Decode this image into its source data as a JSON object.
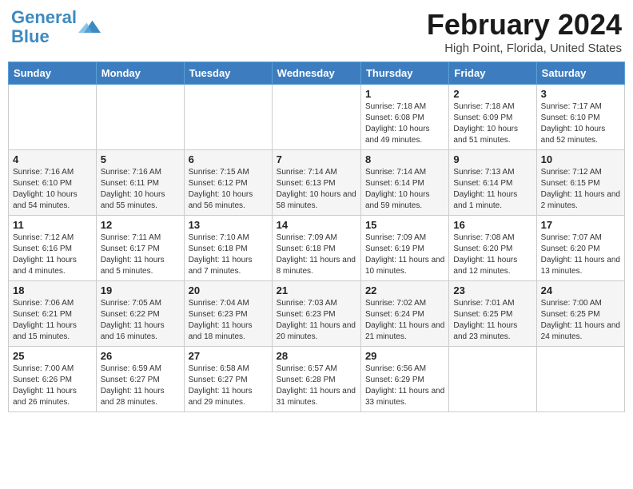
{
  "header": {
    "logo_line1": "General",
    "logo_line2": "Blue",
    "month_title": "February 2024",
    "location": "High Point, Florida, United States"
  },
  "days_of_week": [
    "Sunday",
    "Monday",
    "Tuesday",
    "Wednesday",
    "Thursday",
    "Friday",
    "Saturday"
  ],
  "weeks": [
    [
      {
        "day": "",
        "info": ""
      },
      {
        "day": "",
        "info": ""
      },
      {
        "day": "",
        "info": ""
      },
      {
        "day": "",
        "info": ""
      },
      {
        "day": "1",
        "info": "Sunrise: 7:18 AM\nSunset: 6:08 PM\nDaylight: 10 hours and 49 minutes."
      },
      {
        "day": "2",
        "info": "Sunrise: 7:18 AM\nSunset: 6:09 PM\nDaylight: 10 hours and 51 minutes."
      },
      {
        "day": "3",
        "info": "Sunrise: 7:17 AM\nSunset: 6:10 PM\nDaylight: 10 hours and 52 minutes."
      }
    ],
    [
      {
        "day": "4",
        "info": "Sunrise: 7:16 AM\nSunset: 6:10 PM\nDaylight: 10 hours and 54 minutes."
      },
      {
        "day": "5",
        "info": "Sunrise: 7:16 AM\nSunset: 6:11 PM\nDaylight: 10 hours and 55 minutes."
      },
      {
        "day": "6",
        "info": "Sunrise: 7:15 AM\nSunset: 6:12 PM\nDaylight: 10 hours and 56 minutes."
      },
      {
        "day": "7",
        "info": "Sunrise: 7:14 AM\nSunset: 6:13 PM\nDaylight: 10 hours and 58 minutes."
      },
      {
        "day": "8",
        "info": "Sunrise: 7:14 AM\nSunset: 6:14 PM\nDaylight: 10 hours and 59 minutes."
      },
      {
        "day": "9",
        "info": "Sunrise: 7:13 AM\nSunset: 6:14 PM\nDaylight: 11 hours and 1 minute."
      },
      {
        "day": "10",
        "info": "Sunrise: 7:12 AM\nSunset: 6:15 PM\nDaylight: 11 hours and 2 minutes."
      }
    ],
    [
      {
        "day": "11",
        "info": "Sunrise: 7:12 AM\nSunset: 6:16 PM\nDaylight: 11 hours and 4 minutes."
      },
      {
        "day": "12",
        "info": "Sunrise: 7:11 AM\nSunset: 6:17 PM\nDaylight: 11 hours and 5 minutes."
      },
      {
        "day": "13",
        "info": "Sunrise: 7:10 AM\nSunset: 6:18 PM\nDaylight: 11 hours and 7 minutes."
      },
      {
        "day": "14",
        "info": "Sunrise: 7:09 AM\nSunset: 6:18 PM\nDaylight: 11 hours and 8 minutes."
      },
      {
        "day": "15",
        "info": "Sunrise: 7:09 AM\nSunset: 6:19 PM\nDaylight: 11 hours and 10 minutes."
      },
      {
        "day": "16",
        "info": "Sunrise: 7:08 AM\nSunset: 6:20 PM\nDaylight: 11 hours and 12 minutes."
      },
      {
        "day": "17",
        "info": "Sunrise: 7:07 AM\nSunset: 6:20 PM\nDaylight: 11 hours and 13 minutes."
      }
    ],
    [
      {
        "day": "18",
        "info": "Sunrise: 7:06 AM\nSunset: 6:21 PM\nDaylight: 11 hours and 15 minutes."
      },
      {
        "day": "19",
        "info": "Sunrise: 7:05 AM\nSunset: 6:22 PM\nDaylight: 11 hours and 16 minutes."
      },
      {
        "day": "20",
        "info": "Sunrise: 7:04 AM\nSunset: 6:23 PM\nDaylight: 11 hours and 18 minutes."
      },
      {
        "day": "21",
        "info": "Sunrise: 7:03 AM\nSunset: 6:23 PM\nDaylight: 11 hours and 20 minutes."
      },
      {
        "day": "22",
        "info": "Sunrise: 7:02 AM\nSunset: 6:24 PM\nDaylight: 11 hours and 21 minutes."
      },
      {
        "day": "23",
        "info": "Sunrise: 7:01 AM\nSunset: 6:25 PM\nDaylight: 11 hours and 23 minutes."
      },
      {
        "day": "24",
        "info": "Sunrise: 7:00 AM\nSunset: 6:25 PM\nDaylight: 11 hours and 24 minutes."
      }
    ],
    [
      {
        "day": "25",
        "info": "Sunrise: 7:00 AM\nSunset: 6:26 PM\nDaylight: 11 hours and 26 minutes."
      },
      {
        "day": "26",
        "info": "Sunrise: 6:59 AM\nSunset: 6:27 PM\nDaylight: 11 hours and 28 minutes."
      },
      {
        "day": "27",
        "info": "Sunrise: 6:58 AM\nSunset: 6:27 PM\nDaylight: 11 hours and 29 minutes."
      },
      {
        "day": "28",
        "info": "Sunrise: 6:57 AM\nSunset: 6:28 PM\nDaylight: 11 hours and 31 minutes."
      },
      {
        "day": "29",
        "info": "Sunrise: 6:56 AM\nSunset: 6:29 PM\nDaylight: 11 hours and 33 minutes."
      },
      {
        "day": "",
        "info": ""
      },
      {
        "day": "",
        "info": ""
      }
    ]
  ]
}
